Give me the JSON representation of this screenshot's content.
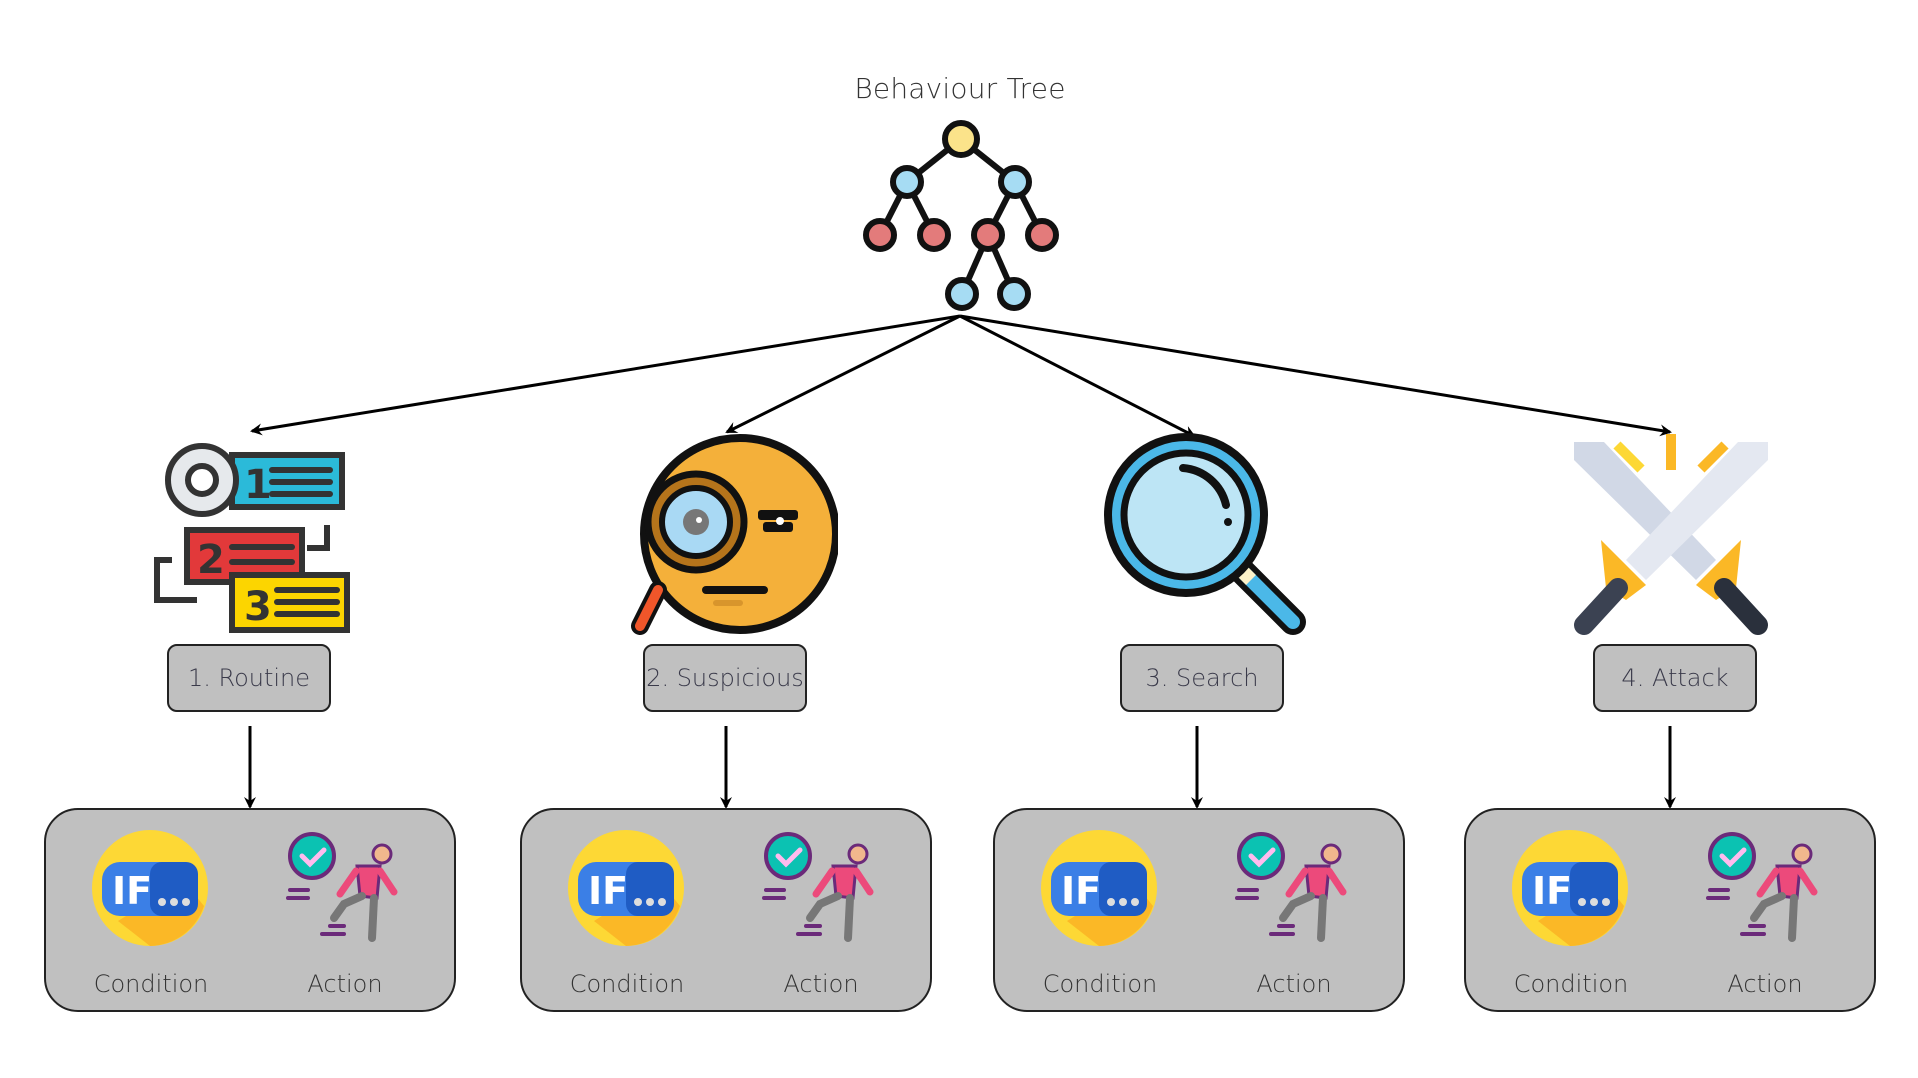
{
  "diagram": {
    "title": "Behaviour Tree",
    "root_icon": "behaviour-tree-icon",
    "states": [
      {
        "id": "routine",
        "label": "1. Routine",
        "icon": "routine-list-gear-icon",
        "children": [
          {
            "label": "Condition",
            "icon": "if-condition-icon"
          },
          {
            "label": "Action",
            "icon": "running-person-icon"
          }
        ]
      },
      {
        "id": "suspicious",
        "label": "2. Suspicious",
        "icon": "suspicious-face-magnifier-icon",
        "children": [
          {
            "label": "Condition",
            "icon": "if-condition-icon"
          },
          {
            "label": "Action",
            "icon": "running-person-icon"
          }
        ]
      },
      {
        "id": "search",
        "label": "3. Search",
        "icon": "magnifying-glass-icon",
        "children": [
          {
            "label": "Condition",
            "icon": "if-condition-icon"
          },
          {
            "label": "Action",
            "icon": "running-person-icon"
          }
        ]
      },
      {
        "id": "attack",
        "label": "4. Attack",
        "icon": "crossed-swords-icon",
        "children": [
          {
            "label": "Condition",
            "icon": "if-condition-icon"
          },
          {
            "label": "Action",
            "icon": "running-person-icon"
          }
        ]
      }
    ],
    "edges": [
      {
        "from": "Behaviour Tree",
        "to": "1. Routine"
      },
      {
        "from": "Behaviour Tree",
        "to": "2. Suspicious"
      },
      {
        "from": "Behaviour Tree",
        "to": "3. Search"
      },
      {
        "from": "Behaviour Tree",
        "to": "4. Attack"
      },
      {
        "from": "1. Routine",
        "to": "Condition/Action"
      },
      {
        "from": "2. Suspicious",
        "to": "Condition/Action"
      },
      {
        "from": "3. Search",
        "to": "Condition/Action"
      },
      {
        "from": "4. Attack",
        "to": "Condition/Action"
      }
    ],
    "colors": {
      "node_fill": "#c0c0c0",
      "node_border": "#222222",
      "edge": "#000000"
    }
  }
}
